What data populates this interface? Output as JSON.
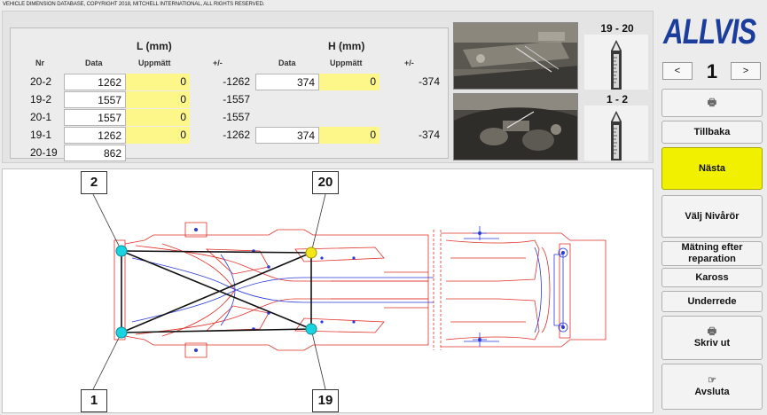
{
  "copyright": "VEHICLE DIMENSION DATABASE, COPYRIGHT 2018, MITCHELL INTERNATIONAL, ALL RIGHTS RESERVED.",
  "table": {
    "group_l": "L (mm)",
    "group_h": "H (mm)",
    "col_nr": "Nr",
    "col_data": "Data",
    "col_uppmatt": "Uppmätt",
    "col_diff": "+/-",
    "rows": [
      {
        "nr": "20-2",
        "l_data": "1262",
        "l_upp": "0",
        "l_diff": "-1262",
        "h_data": "374",
        "h_upp": "0",
        "h_diff": "-374"
      },
      {
        "nr": "19-2",
        "l_data": "1557",
        "l_upp": "0",
        "l_diff": "-1557"
      },
      {
        "nr": "20-1",
        "l_data": "1557",
        "l_upp": "0",
        "l_diff": "-1557"
      },
      {
        "nr": "19-1",
        "l_data": "1262",
        "l_upp": "0",
        "l_diff": "-1262",
        "h_data": "374",
        "h_upp": "0",
        "h_diff": "-374"
      },
      {
        "nr": "20-19",
        "l_data": "862"
      }
    ]
  },
  "rulers": {
    "top_label": "19 - 20",
    "bottom_label": "1 - 2"
  },
  "logo": "ALLVIS",
  "pager": {
    "prev": "<",
    "page": "1",
    "next": ">"
  },
  "buttons": {
    "print_small_icon": "printer-icon",
    "tillbaka": "Tillbaka",
    "nasta": "Nästa",
    "valj_nivaror": "Välj Nivårör",
    "matning": "Mätning efter reparation",
    "kaross": "Kaross",
    "underrede": "Underrede",
    "skriv_ut": "Skriv ut",
    "avsluta": "Avsluta"
  },
  "diagram": {
    "points": [
      {
        "id": "2",
        "label": "2",
        "color": "#19d3e0"
      },
      {
        "id": "20",
        "label": "20",
        "color": "#f5e61a"
      },
      {
        "id": "1",
        "label": "1",
        "color": "#19d3e0"
      },
      {
        "id": "19",
        "label": "19",
        "color": "#19d3e0"
      }
    ]
  },
  "colors": {
    "accent_yellow": "#f0f000",
    "measured_yellow": "#fdf78a",
    "logo_blue": "#1b3e9c",
    "frame_red": "#e0302a",
    "frame_blue": "#2a3ad8"
  }
}
